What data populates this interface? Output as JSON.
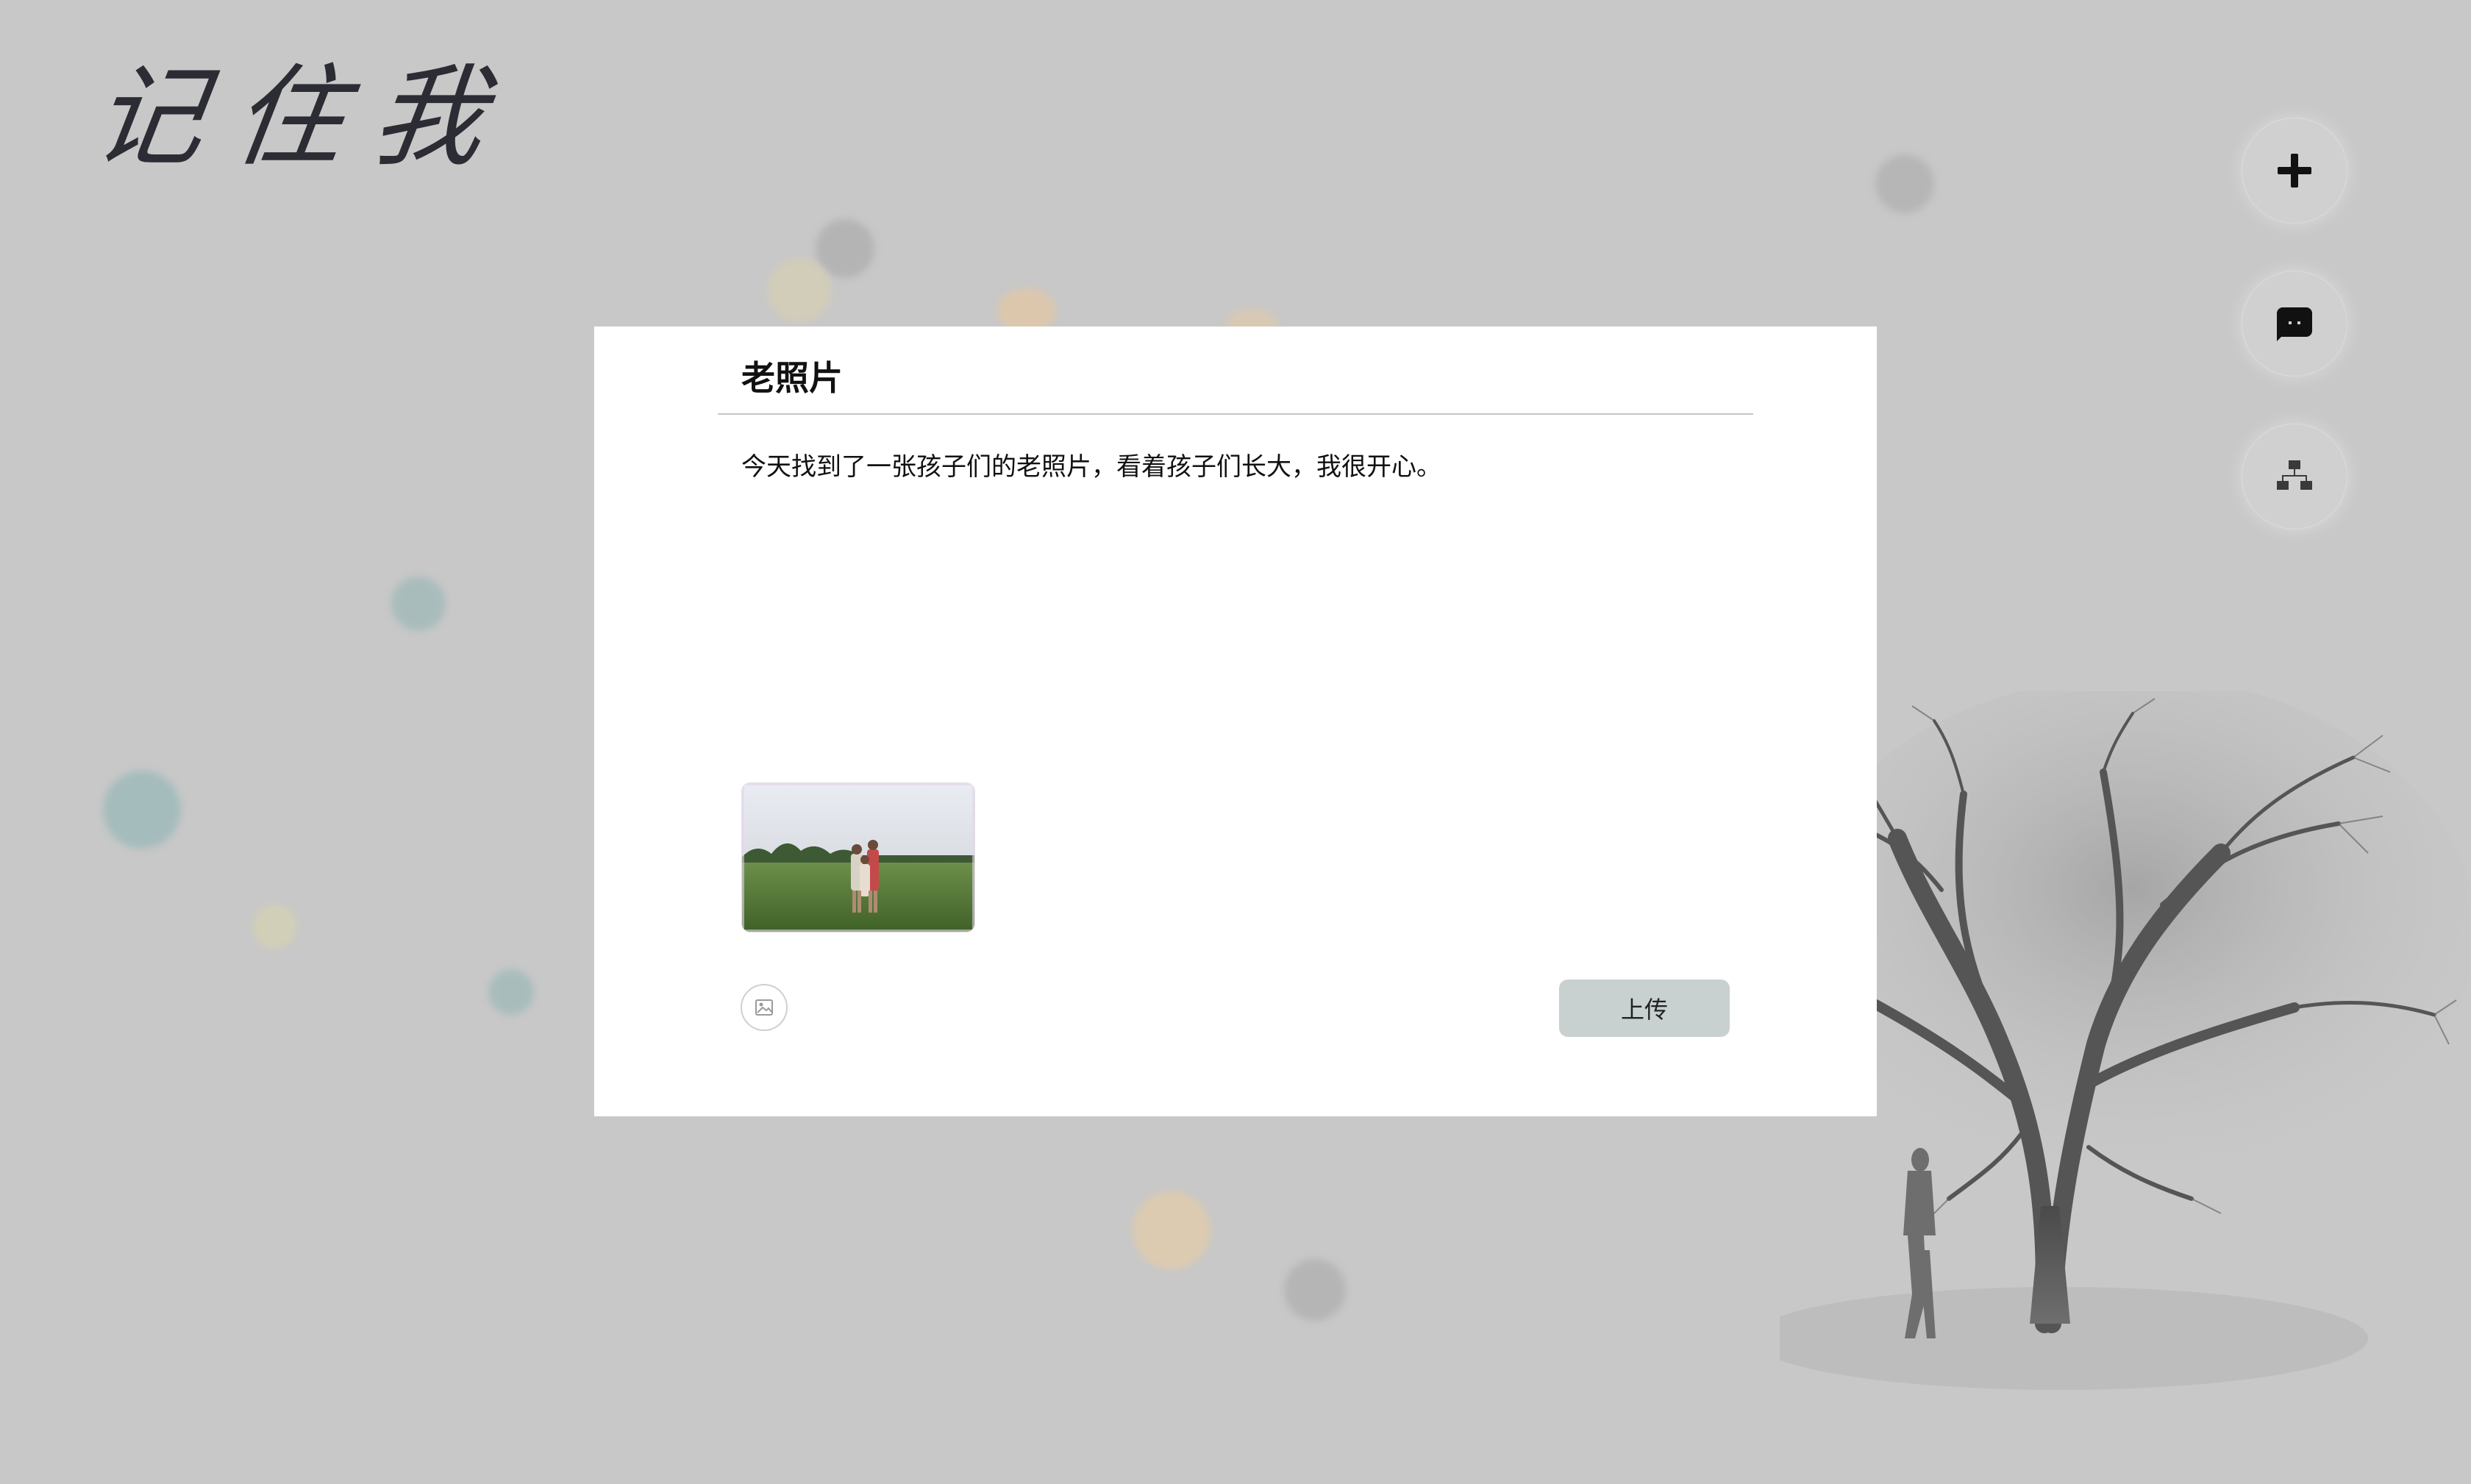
{
  "app": {
    "logo_text": "记住我"
  },
  "sidebar_actions": [
    {
      "icon": "plus-icon",
      "action": "add"
    },
    {
      "icon": "chat-bubble-icon",
      "action": "chat"
    },
    {
      "icon": "sitemap-icon",
      "action": "family-tree"
    }
  ],
  "dialog": {
    "title": "老照片",
    "body": "今天找到了一张孩子们的老照片，看着孩子们长大，我很开心。",
    "image_button_icon": "image-icon",
    "upload_label": "上传"
  },
  "colors": {
    "background": "#c8c8c8",
    "dialog_bg": "#ffffff",
    "upload_button_bg": "#c8d0d0",
    "logo_ink": "#2c2c34"
  }
}
